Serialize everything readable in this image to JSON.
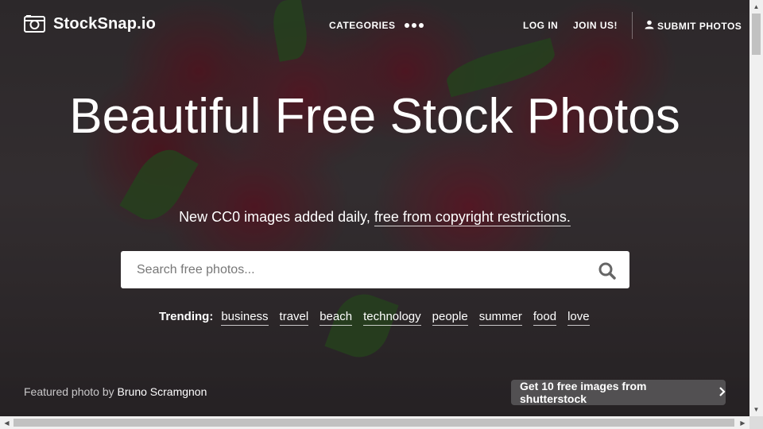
{
  "brand": {
    "name": "StockSnap.io",
    "logo_icon": "camera-icon"
  },
  "nav": {
    "categories_label": "CATEGORIES",
    "more_icon": "more-dots-icon",
    "login_label": "LOG IN",
    "join_label": "JOIN US!",
    "submit_label": "SUBMIT PHOTOS",
    "submit_icon": "upload-icon"
  },
  "hero": {
    "title": "Beautiful Free Stock Photos",
    "subtitle_prefix": "New CC0 images added daily, ",
    "subtitle_link": "free from copyright restrictions."
  },
  "search": {
    "placeholder": "Search free photos...",
    "value": "",
    "button_icon": "search-icon"
  },
  "trending": {
    "label": "Trending:",
    "tags": [
      "business",
      "travel",
      "beach",
      "technology",
      "people",
      "summer",
      "food",
      "love"
    ]
  },
  "credit": {
    "prefix": "Featured photo by ",
    "author": "Bruno Scramgnon"
  },
  "promo": {
    "label": "Get 10 free images from shutterstock",
    "icon": "chevron-right-icon"
  },
  "colors": {
    "overlay": "#2e2a2c",
    "promo_bg": "#5a585a",
    "text": "#ffffff"
  }
}
